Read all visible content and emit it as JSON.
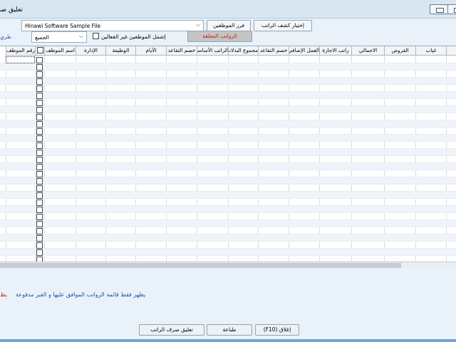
{
  "window": {
    "title": "تعليق صرف"
  },
  "toolbar": {
    "company_combo": "Hinawi Software Sample File",
    "sort_button": "فرز الموظفين",
    "select_payroll_button": "إختيار كشف الراتب",
    "frozen_salaries_button": "الرواتب المعلقة",
    "filter_combo": "الجميع",
    "include_inactive_label": "إشمل الموظفين غير الفعالين",
    "method_label": "طري"
  },
  "grid": {
    "columns": [
      "رقم الموظف",
      "",
      "اسم الموظف",
      "الإدارة",
      "الوظيفة",
      "الأيام",
      "خصم التقاعد",
      "الراتب الأساسي",
      "مجموع البدلات",
      "خصم التقاعد",
      "العمل الإضافي الوقت الإضافي",
      "راتب الاجازة",
      "الاجمالي",
      "القروض",
      "غياب",
      "ت"
    ]
  },
  "footer": {
    "note": "يظهر فقط قائمة الرواتب الموافق عليها و الغير مدفوعة",
    "note_prefix": "يظ",
    "suspend_button": "تعليق صرف الراتب",
    "print_button": "طباعة",
    "close_button": "إغلاق (F10)"
  }
}
